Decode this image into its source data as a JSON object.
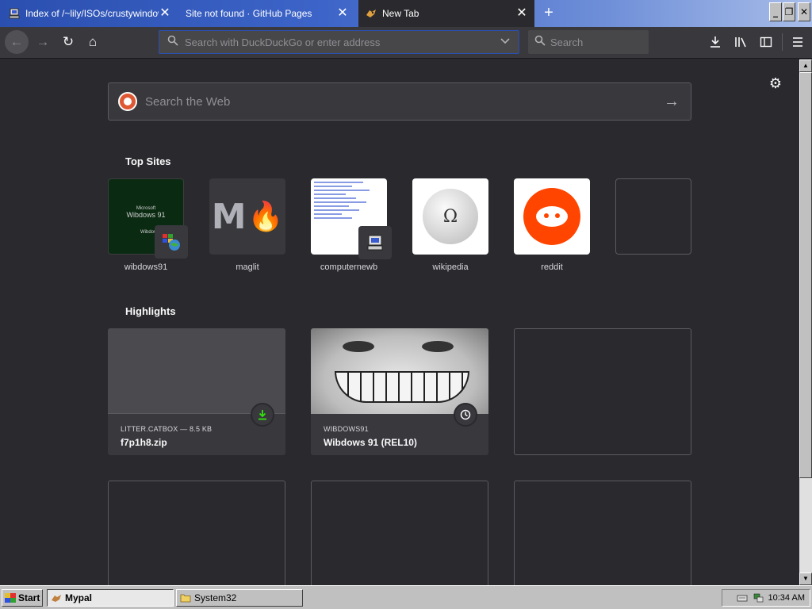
{
  "tabs": [
    {
      "label": "Index of /~lily/ISOs/crustywindows/",
      "favicon": "computer-icon"
    },
    {
      "label": "Site not found · GitHub Pages",
      "favicon": "none"
    },
    {
      "label": "New Tab",
      "favicon": "fox-icon"
    }
  ],
  "toolbar": {
    "url_placeholder": "Search with DuckDuckGo or enter address",
    "search_placeholder": "Search"
  },
  "newtab": {
    "web_search_placeholder": "Search the Web",
    "top_sites_title": "Top Sites",
    "highlights_title": "Highlights",
    "top_sites": [
      {
        "name": "wibdows91",
        "tile_text_top": "Microsoft",
        "tile_text_main": "Wibdows 91",
        "tile_text_bottom": "Wibdows"
      },
      {
        "name": "maglit",
        "tile_letter": "M"
      },
      {
        "name": "computernewb"
      },
      {
        "name": "wikipedia",
        "tile_letter": "Ω"
      },
      {
        "name": "reddit"
      },
      {
        "name": ""
      }
    ],
    "highlights": [
      {
        "host": "LITTER.CATBOX — 8.5 KB",
        "title": "f7p1h8.zip",
        "type": "download"
      },
      {
        "host": "WIBDOWS91",
        "title": "Wibdows 91 (REL10)",
        "type": "history"
      }
    ]
  },
  "taskbar": {
    "start_label": "Start",
    "tasks": [
      {
        "label": "Mypal"
      },
      {
        "label": "System32"
      }
    ],
    "clock": "10:34 AM"
  },
  "colors": {
    "accent": "#2a4fb0",
    "page_bg": "#2a2a2e",
    "reddit": "#ff4500",
    "ddg": "#de5833",
    "download_green": "#30e60b"
  }
}
